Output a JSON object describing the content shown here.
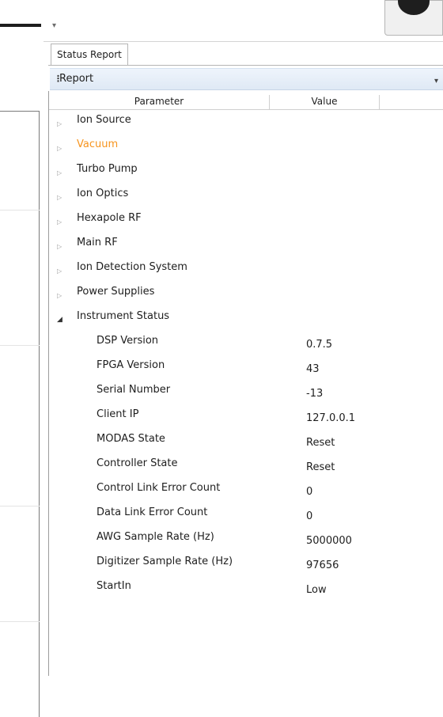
{
  "panel": {
    "tab_label": "Status Report",
    "toolbar_label": "Report",
    "columns": [
      "Parameter",
      "Value"
    ]
  },
  "groups": [
    {
      "label": "Ion Source",
      "state": "collapsed"
    },
    {
      "label": "Vacuum",
      "state": "collapsed",
      "color": "#f7941d"
    },
    {
      "label": "Turbo Pump",
      "state": "collapsed"
    },
    {
      "label": "Ion Optics",
      "state": "collapsed"
    },
    {
      "label": "Hexapole RF",
      "state": "collapsed"
    },
    {
      "label": "Main RF",
      "state": "collapsed"
    },
    {
      "label": "Ion Detection System",
      "state": "collapsed"
    },
    {
      "label": "Power Supplies",
      "state": "collapsed"
    },
    {
      "label": "Instrument Status",
      "state": "expanded"
    }
  ],
  "instrument_status": [
    {
      "parameter": "DSP Version",
      "value": "0.7.5"
    },
    {
      "parameter": "FPGA Version",
      "value": "43"
    },
    {
      "parameter": "Serial Number",
      "value": "-13"
    },
    {
      "parameter": "Client IP",
      "value": "127.0.0.1"
    },
    {
      "parameter": "MODAS State",
      "value": "Reset"
    },
    {
      "parameter": "Controller State",
      "value": "Reset"
    },
    {
      "parameter": "Control Link Error Count",
      "value": "0"
    },
    {
      "parameter": "Data Link Error Count",
      "value": "0"
    },
    {
      "parameter": "AWG Sample Rate (Hz)",
      "value": "5000000"
    },
    {
      "parameter": "Digitizer Sample Rate (Hz)",
      "value": "97656"
    },
    {
      "parameter": "StartIn",
      "value": "Low"
    }
  ],
  "icons": {
    "overflow": "overflow-chevron-icon",
    "grip": "toolbar-grip-icon",
    "collapsed": "triangle-right-icon",
    "expanded": "triangle-down-icon"
  },
  "colors": {
    "warning_text": "#f7941d",
    "toolbar_bg": "#e6eef8"
  }
}
